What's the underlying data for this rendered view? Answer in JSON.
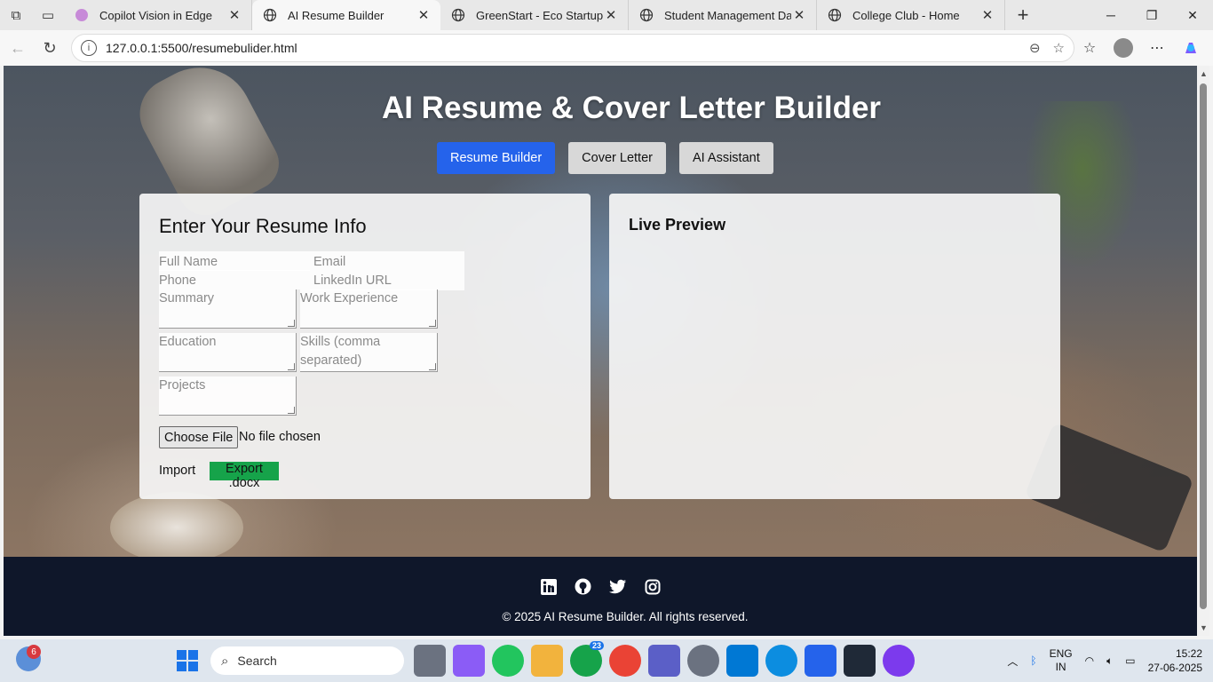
{
  "browser": {
    "tabs": [
      {
        "title": "Copilot Vision in Edge",
        "active": false
      },
      {
        "title": "AI Resume Builder",
        "active": true
      },
      {
        "title": "GreenStart - Eco Startup Lan",
        "active": false
      },
      {
        "title": "Student Management Dashb",
        "active": false
      },
      {
        "title": "College Club - Home",
        "active": false
      }
    ],
    "url": "127.0.0.1:5500/resumebulider.html"
  },
  "page": {
    "title": "AI Resume & Cover Letter Builder",
    "tabs": [
      "Resume Builder",
      "Cover Letter",
      "AI Assistant"
    ],
    "form": {
      "heading": "Enter Your Resume Info",
      "placeholders": {
        "full_name": "Full Name",
        "email": "Email",
        "phone": "Phone",
        "linkedin": "LinkedIn URL",
        "summary": "Summary",
        "work_experience": "Work Experience",
        "education": "Education",
        "skills": "Skills (comma separated)",
        "projects": "Projects"
      },
      "file_button": "Choose File",
      "file_status": "No file chosen",
      "import_label": "Import",
      "export_button": "Export .docx"
    },
    "preview": {
      "heading": "Live Preview"
    },
    "footer": {
      "social_icons": [
        "linkedin-icon",
        "github-icon",
        "twitter-icon",
        "instagram-icon"
      ],
      "copyright": "© 2025 AI Resume Builder. All rights reserved."
    },
    "colors": {
      "primary": "#2563eb",
      "export": "#16a34a",
      "footer_bg": "#0f172a"
    }
  },
  "taskbar": {
    "widget_badge": "6",
    "search_placeholder": "Search",
    "whatsapp_badge": "23",
    "lang_line1": "ENG",
    "lang_line2": "IN",
    "time": "15:22",
    "date": "27-06-2025"
  }
}
